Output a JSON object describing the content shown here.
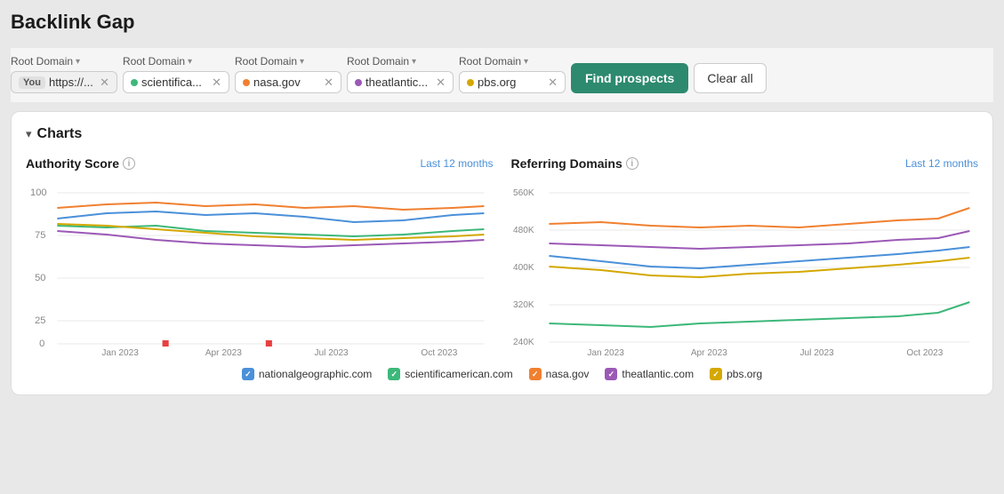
{
  "page": {
    "title": "Backlink Gap"
  },
  "toolbar": {
    "find_prospects_label": "Find prospects",
    "clear_all_label": "Clear all"
  },
  "domain_groups": [
    {
      "label": "Root Domain",
      "chips": [
        {
          "id": "you",
          "badge": "You",
          "text": "https://...",
          "color": null,
          "dot_color": null,
          "is_you": true
        }
      ]
    },
    {
      "label": "Root Domain",
      "chips": [
        {
          "id": "sci",
          "text": "scientifica...",
          "dot_color": "#3db87a",
          "is_you": false
        }
      ]
    },
    {
      "label": "Root Domain",
      "chips": [
        {
          "id": "nasa",
          "text": "nasa.gov",
          "dot_color": "#f08030",
          "is_you": false
        }
      ]
    },
    {
      "label": "Root Domain",
      "chips": [
        {
          "id": "atlantic",
          "text": "theatlantic...",
          "dot_color": "#9b59b6",
          "is_you": false
        }
      ]
    },
    {
      "label": "Root Domain",
      "chips": [
        {
          "id": "pbs",
          "text": "pbs.org",
          "dot_color": "#d4a800",
          "is_you": false
        }
      ]
    }
  ],
  "charts": {
    "toggle_label": "▾",
    "section_title": "Charts",
    "authority_score": {
      "title": "Authority Score",
      "period": "Last 12 months",
      "y_labels": [
        "100",
        "75",
        "50",
        "25",
        "0"
      ],
      "x_labels": [
        "Jan 2023",
        "Apr 2023",
        "Jul 2023",
        "Oct 2023"
      ]
    },
    "referring_domains": {
      "title": "Referring Domains",
      "period": "Last 12 months",
      "y_labels": [
        "560K",
        "480K",
        "400K",
        "320K",
        "240K"
      ],
      "x_labels": [
        "Jan 2023",
        "Apr 2023",
        "Jul 2023",
        "Oct 2023"
      ]
    }
  },
  "legend": [
    {
      "id": "ng",
      "label": "nationalgeographic.com",
      "color": "#4a90d9",
      "type": "check"
    },
    {
      "id": "sci",
      "label": "scientificamerican.com",
      "color": "#3db87a",
      "type": "check"
    },
    {
      "id": "nasa",
      "label": "nasa.gov",
      "color": "#f08030",
      "type": "check"
    },
    {
      "id": "atlantic",
      "label": "theatlantic.com",
      "color": "#9b59b6",
      "type": "check"
    },
    {
      "id": "pbs",
      "label": "pbs.org",
      "color": "#d4a800",
      "type": "check"
    }
  ]
}
